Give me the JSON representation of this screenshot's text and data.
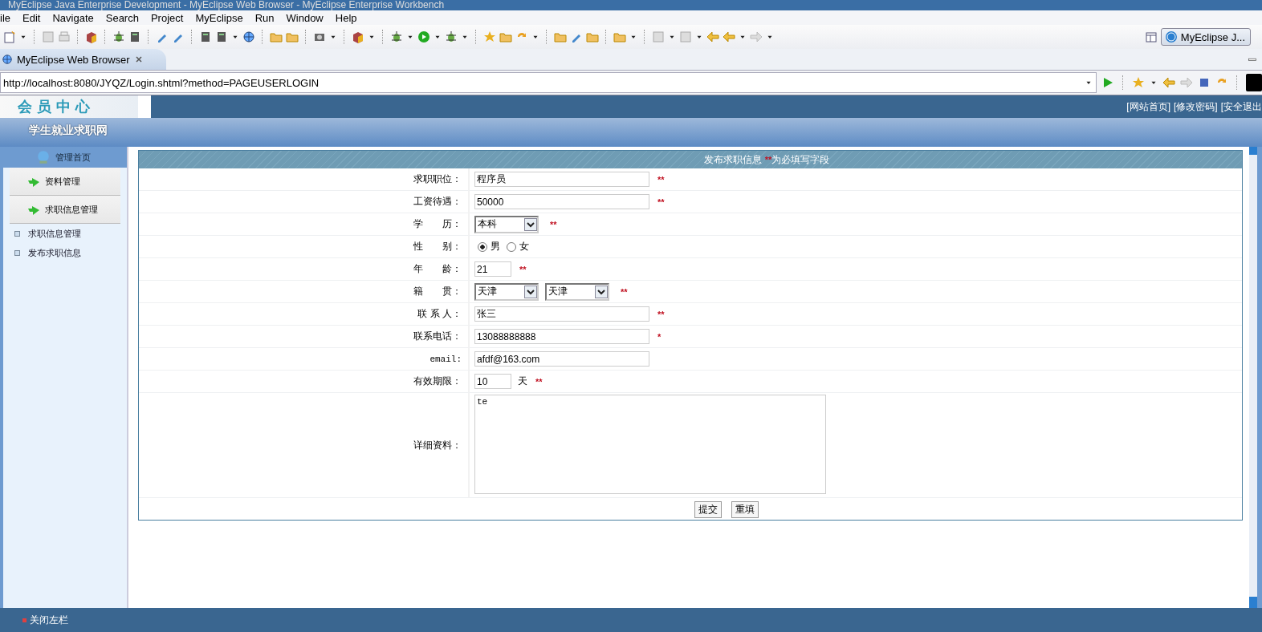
{
  "window": {
    "title": "MyEclipse Java Enterprise Development - MyEclipse Web Browser - MyEclipse Enterprise Workbench"
  },
  "menu": [
    "ile",
    "Edit",
    "Navigate",
    "Search",
    "Project",
    "MyEclipse",
    "Run",
    "Window",
    "Help"
  ],
  "perspective": {
    "label": "MyEclipse J..."
  },
  "editor_tabs": [
    {
      "label": "MyEclipse Web Browser",
      "selected": true
    }
  ],
  "address_bar": {
    "value": "http://localhost:8080/JYQZ/Login.shtml?method=PAGEUSERLOGIN"
  },
  "site": {
    "logo": "会员中心",
    "name": "学生就业求职网",
    "top_links": [
      "[网站首页]",
      "[修改密码]",
      "[安全退出"
    ]
  },
  "sidebar": {
    "home": "管理首页",
    "sections": [
      "资料管理",
      "求职信息管理"
    ],
    "links": [
      "求职信息管理",
      "发布求职信息"
    ]
  },
  "form": {
    "title": "发布求职信息",
    "title_mark": "**",
    "title_note": "为必填写字段",
    "rows": [
      {
        "kind": "text",
        "label": "求职职位：",
        "value": "程序员",
        "mark": "**"
      },
      {
        "kind": "text",
        "label": "工资待遇：",
        "value": "50000",
        "mark": "**"
      },
      {
        "kind": "select",
        "label": "学　　历：",
        "selects": [
          "本科"
        ],
        "mark": "**"
      },
      {
        "kind": "radio",
        "label": "性　　别：",
        "options": [
          {
            "label": "男",
            "selected": true
          },
          {
            "label": "女",
            "selected": false
          }
        ]
      },
      {
        "kind": "short",
        "label": "年　　龄：",
        "value": "21",
        "mark": "**"
      },
      {
        "kind": "select",
        "label": "籍　　贯：",
        "selects": [
          "天津",
          "天津"
        ],
        "mark": "**"
      },
      {
        "kind": "text",
        "label": "联 系 人：",
        "value": "张三",
        "mark": "**"
      },
      {
        "kind": "text",
        "label": "联系电话：",
        "value": "13088888888",
        "mark": "*"
      },
      {
        "kind": "text",
        "label": "email:",
        "value": "afdf@163.com"
      },
      {
        "kind": "short",
        "label": "有效期限：",
        "value": "10",
        "unit": "天",
        "mark": "**"
      },
      {
        "kind": "textarea",
        "label": "详细资料：",
        "value": "te"
      }
    ],
    "buttons": [
      "提交",
      "重填"
    ]
  },
  "status_bar": {
    "label": "关闭左栏"
  }
}
